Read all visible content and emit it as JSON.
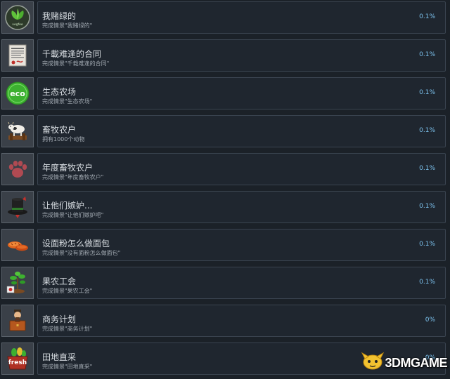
{
  "achievements": [
    {
      "title": "我赌绿的",
      "desc": "完成情景\"我赌绿的\"",
      "percent": "0.1%",
      "icon": "green-leaves-icon"
    },
    {
      "title": "千載难逢的合同",
      "desc": "完成情景\"千载难逢的合同\"",
      "percent": "0.1%",
      "icon": "contract-document-icon"
    },
    {
      "title": "生态农场",
      "desc": "完成情景\"生态农场\"",
      "percent": "0.1%",
      "icon": "eco-badge-icon"
    },
    {
      "title": "畜牧农户",
      "desc": "拥有1000个动物",
      "percent": "0.1%",
      "icon": "cow-icon"
    },
    {
      "title": "年度畜牧农户",
      "desc": "完成情景\"年度畜牧农户\"",
      "percent": "0.1%",
      "icon": "paw-print-icon"
    },
    {
      "title": "让他们嫉妒...",
      "desc": "完成情景\"让他们嫉妒吧\"",
      "percent": "0.1%",
      "icon": "top-hat-icon"
    },
    {
      "title": "设面粉怎么做面包",
      "desc": "完成情景\"没有面粉怎么做面包\"",
      "percent": "0.1%",
      "icon": "bread-icon"
    },
    {
      "title": "果农工会",
      "desc": "完成情景\"果农工会\"",
      "percent": "0.1%",
      "icon": "sapling-icon"
    },
    {
      "title": "商务计划",
      "desc": "完成情景\"商务计划\"",
      "percent": "0%",
      "icon": "businessman-icon"
    },
    {
      "title": "田地直采",
      "desc": "完成情景\"田地直采\"",
      "percent": "0%",
      "icon": "fresh-basket-icon"
    }
  ],
  "icon_labels": {
    "eco": "eco",
    "fresh": "fresh",
    "veg": "vegfee"
  },
  "watermark": {
    "text": "3DMGAME"
  },
  "colors": {
    "background": "#1b2128",
    "row": "#1f262f",
    "percent": "#7cc2ee"
  }
}
